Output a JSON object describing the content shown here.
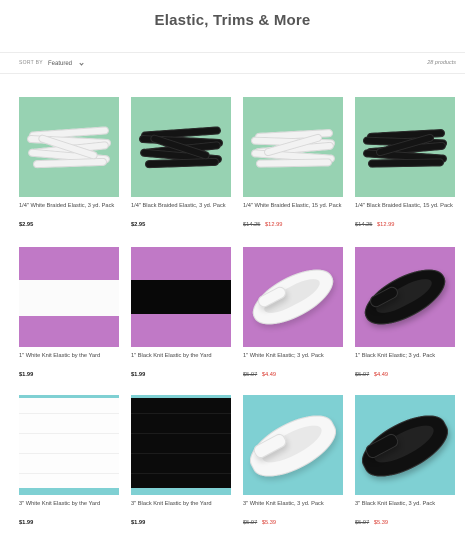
{
  "page": {
    "title": "Elastic, Trims & More"
  },
  "toolbar": {
    "sort_label": "SORT BY",
    "sort_value": "Featured",
    "product_count": "28 products"
  },
  "colors": {
    "mint": "#97d2b2",
    "purple": "#c079c6",
    "teal": "#7fd0d3",
    "sale": "#d9372d"
  },
  "products": [
    {
      "title": "1/4\" White Braided Elastic, 3 yd. Pack",
      "price": "$2.95",
      "old_price": "",
      "sale_price": "",
      "bg": "mint",
      "image": "white-braided-bundle"
    },
    {
      "title": "1/4\" Black Braided Elastic, 3 yd. Pack",
      "price": "$2.95",
      "old_price": "",
      "sale_price": "",
      "bg": "mint",
      "image": "black-braided-bundle"
    },
    {
      "title": "1/4\" White Braided Elastic, 15 yd. Pack",
      "price": "",
      "old_price": "$14.25",
      "sale_price": "$12.99",
      "bg": "mint",
      "image": "white-braided-bundle-large"
    },
    {
      "title": "1/4\" Black Braided Elastic, 15 yd. Pack",
      "price": "",
      "old_price": "$14.25",
      "sale_price": "$12.99",
      "bg": "mint",
      "image": "black-braided-bundle-large"
    },
    {
      "title": "1\" White Knit Elastic by the Yard",
      "price": "$1.99",
      "old_price": "",
      "sale_price": "",
      "bg": "purple",
      "image": "white-knit-band"
    },
    {
      "title": "1\" Black Knit Elastic by the Yard",
      "price": "$1.99",
      "old_price": "",
      "sale_price": "",
      "bg": "purple",
      "image": "black-knit-band"
    },
    {
      "title": "1\" White Knit Elastic; 3 yd. Pack",
      "price": "",
      "old_price": "$5.07",
      "sale_price": "$4.49",
      "bg": "purple",
      "image": "white-knit-coil"
    },
    {
      "title": "1\" Black Knit Elastic; 3 yd. Pack",
      "price": "",
      "old_price": "$5.07",
      "sale_price": "$4.49",
      "bg": "purple",
      "image": "black-knit-coil"
    },
    {
      "title": "3\" White Knit Elastic by the Yard",
      "price": "$1.99",
      "old_price": "",
      "sale_price": "",
      "bg": "teal",
      "image": "white-wide-swatch"
    },
    {
      "title": "3\" Black Knit Elastic by the Yard",
      "price": "$1.99",
      "old_price": "",
      "sale_price": "",
      "bg": "teal",
      "image": "black-wide-swatch"
    },
    {
      "title": "3\" White Knit Elastic, 3 yd. Pack",
      "price": "",
      "old_price": "$5.97",
      "sale_price": "$5.39",
      "bg": "teal",
      "image": "white-wide-coil"
    },
    {
      "title": "3\" Black Knit Elastic, 3 yd. Pack",
      "price": "",
      "old_price": "$5.97",
      "sale_price": "$5.39",
      "bg": "teal",
      "image": "black-wide-coil"
    }
  ]
}
